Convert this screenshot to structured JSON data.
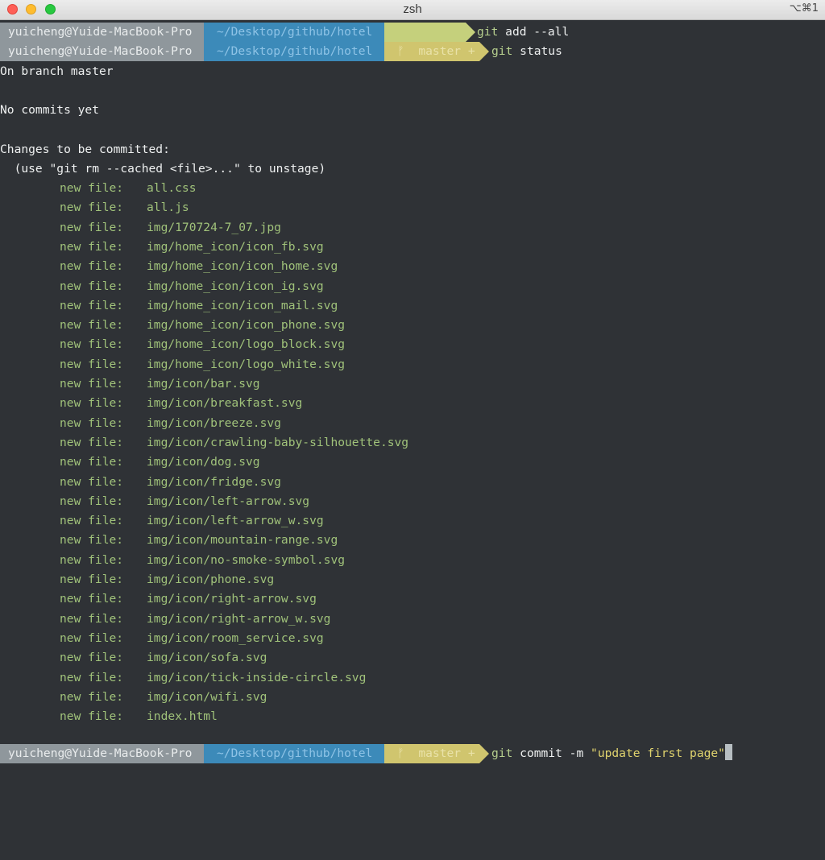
{
  "window": {
    "title": "zsh",
    "shortcut": "⌥⌘1"
  },
  "prompt": {
    "user_host": "yuicheng@Yuide-MacBook-Pro",
    "path": "~/Desktop/github/hotel",
    "branch_icon": "ᚠ",
    "branch": "master",
    "dirty_marker": "+"
  },
  "colors": {
    "background": "#2f3236",
    "user_segment": "#8f979c",
    "path_segment": "#3c8ab9",
    "git_segment": "#d0c56e",
    "staged_file": "#a0c27a",
    "string": "#e0d36e"
  },
  "commands": {
    "first": {
      "name": "git",
      "args": "add --all"
    },
    "second": {
      "name": "git",
      "args": "status"
    },
    "third": {
      "name": "git",
      "args": "commit -m ",
      "message": "\"update first page\""
    }
  },
  "output": {
    "branch_line": "On branch master",
    "no_commits": "No commits yet",
    "changes_header": "Changes to be committed:",
    "unstage_hint": "  (use \"git rm --cached <file>...\" to unstage)",
    "new_file_label": "new file:",
    "files": [
      "all.css",
      "all.js",
      "img/170724-7_07.jpg",
      "img/home_icon/icon_fb.svg",
      "img/home_icon/icon_home.svg",
      "img/home_icon/icon_ig.svg",
      "img/home_icon/icon_mail.svg",
      "img/home_icon/icon_phone.svg",
      "img/home_icon/logo_block.svg",
      "img/home_icon/logo_white.svg",
      "img/icon/bar.svg",
      "img/icon/breakfast.svg",
      "img/icon/breeze.svg",
      "img/icon/crawling-baby-silhouette.svg",
      "img/icon/dog.svg",
      "img/icon/fridge.svg",
      "img/icon/left-arrow.svg",
      "img/icon/left-arrow_w.svg",
      "img/icon/mountain-range.svg",
      "img/icon/no-smoke-symbol.svg",
      "img/icon/phone.svg",
      "img/icon/right-arrow.svg",
      "img/icon/right-arrow_w.svg",
      "img/icon/room_service.svg",
      "img/icon/sofa.svg",
      "img/icon/tick-inside-circle.svg",
      "img/icon/wifi.svg",
      "index.html"
    ]
  }
}
